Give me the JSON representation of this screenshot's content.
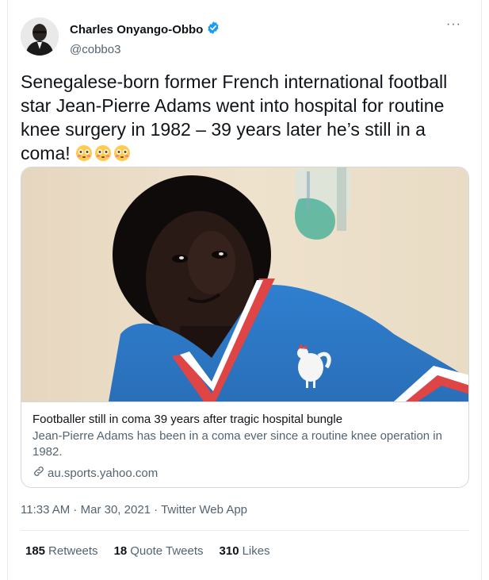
{
  "author": {
    "display_name": "Charles Onyango-Obbo",
    "handle": "@cobbo3",
    "verified": true
  },
  "tweet": {
    "text": "Senegalese-born former French international football star Jean-Pierre Adams went into hospital for routine knee surgery in 1982 – 39 years later he’s still in a coma!",
    "emojis": [
      "flushed-face-icon",
      "flushed-face-icon",
      "flushed-face-icon"
    ]
  },
  "card": {
    "title": "Footballer still in coma 39 years after tragic hospital bungle",
    "description": "Jean-Pierre Adams has been in a coma ever since a routine knee operation in 1982.",
    "domain": "au.sports.yahoo.com",
    "image_icon": "footballer-photo"
  },
  "meta": {
    "time": "11:33 AM",
    "separator": " · ",
    "date": "Mar 30, 2021",
    "app": "Twitter Web App"
  },
  "stats": {
    "retweets_count": "185",
    "retweets_label": "Retweets",
    "quote_count": "18",
    "quote_label": "Quote Tweets",
    "likes_count": "310",
    "likes_label": "Likes"
  },
  "colors": {
    "verified_blue": "#1d9bf0",
    "secondary_text": "#536471",
    "primary_text": "#0f1419",
    "border": "#cfd9de"
  }
}
